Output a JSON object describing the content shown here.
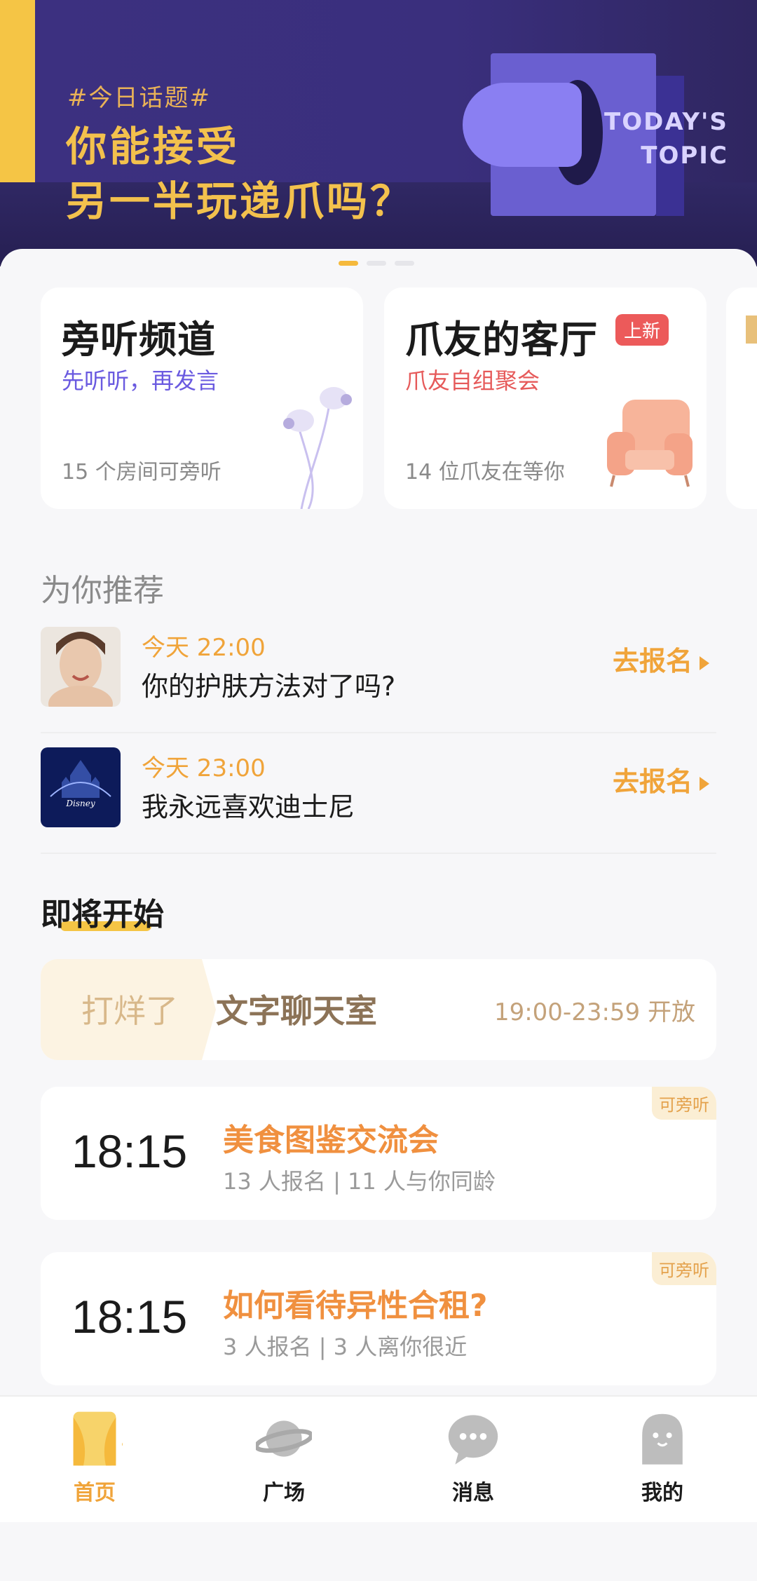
{
  "banner": {
    "tag": "#今日话题#",
    "title_line1": "你能接受",
    "title_line2": "另一半玩递爪吗？",
    "todays_line1": "TODAY'S",
    "todays_line2": "TOPIC"
  },
  "carousel": {
    "total": 3,
    "active": 1
  },
  "channels": [
    {
      "title": "旁听频道",
      "subtitle": "先听听，再发言",
      "meta": "15 个房间可旁听",
      "accent": "#6a5ae0",
      "highlight": "#b9b0f5"
    },
    {
      "title": "爪友的客厅",
      "subtitle": "爪友自组聚会",
      "meta": "14 位爪友在等你",
      "badge": "上新",
      "accent": "#e65a5a",
      "highlight": "#f3b4c2"
    }
  ],
  "recommend": {
    "heading": "为你推荐",
    "items": [
      {
        "time": "今天 22:00",
        "title": "你的护肤方法对了吗?",
        "action": "去报名"
      },
      {
        "time": "今天 23:00",
        "title": "我永远喜欢迪士尼",
        "action": "去报名"
      }
    ]
  },
  "upcoming": {
    "heading": "即将开始",
    "chatroom": {
      "tag": "打烊了",
      "name": "文字聊天室",
      "hours": "19:00-23:59 开放"
    },
    "rooms": [
      {
        "time": "18:15",
        "title": "美食图鉴交流会",
        "stats": "13 人报名  |  11 人与你同龄",
        "flag": "可旁听"
      },
      {
        "time": "18:15",
        "title": "如何看待异性合租?",
        "stats": "3 人报名  |  3 人离你很近",
        "flag": "可旁听"
      }
    ]
  },
  "nav": [
    {
      "label": "首页",
      "icon": "curtain-icon",
      "active": true
    },
    {
      "label": "广场",
      "icon": "planet-icon"
    },
    {
      "label": "消息",
      "icon": "chat-bubble-icon"
    },
    {
      "label": "我的",
      "icon": "ghost-icon"
    }
  ],
  "colors": {
    "accent": "#f0a43a",
    "banner_bg": "#3c3080",
    "banner_text": "#f3c14d"
  }
}
